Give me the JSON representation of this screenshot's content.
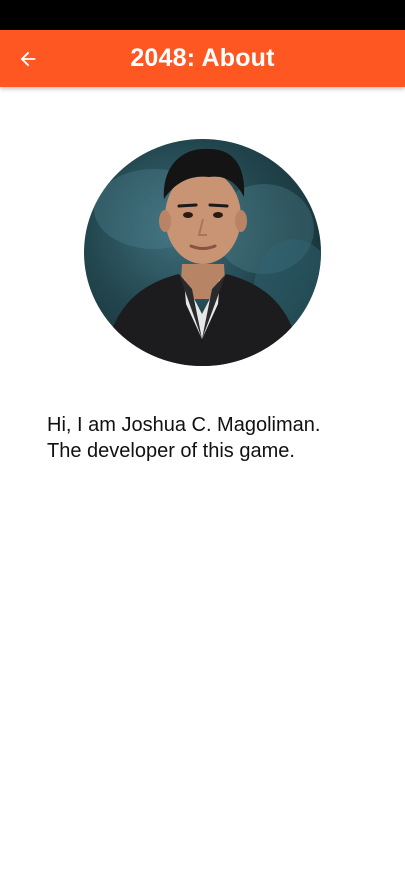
{
  "status_bar": {},
  "app_bar": {
    "title": "2048: About",
    "back_icon": "arrow-back-icon",
    "color": "#ff5722"
  },
  "profile": {
    "image": "developer-portrait"
  },
  "about": {
    "line1": "Hi, I am Joshua C. Magoliman.",
    "line2": "The developer of this game."
  }
}
